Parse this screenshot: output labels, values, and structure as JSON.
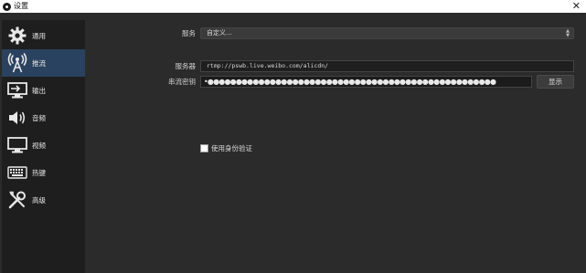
{
  "window": {
    "title": "设置"
  },
  "sidebar": {
    "items": [
      {
        "label": "通用",
        "icon": "gear-icon",
        "active": false
      },
      {
        "label": "推流",
        "icon": "broadcast-antenna-icon",
        "active": true
      },
      {
        "label": "输出",
        "icon": "output-monitor-icon",
        "active": false
      },
      {
        "label": "音频",
        "icon": "speaker-icon",
        "active": false
      },
      {
        "label": "视频",
        "icon": "monitor-icon",
        "active": false
      },
      {
        "label": "热键",
        "icon": "keyboard-icon",
        "active": false
      },
      {
        "label": "高级",
        "icon": "tools-icon",
        "active": false
      }
    ]
  },
  "stream": {
    "service_label": "服务",
    "service_value": "自定义...",
    "server_label": "服务器",
    "server_value": "rtmp://pswb.live.weibo.com/alicdn/",
    "key_label": "串流密钥",
    "key_masked": "•●●●●●●●●●●●●●●●●●●●●●●●●●●●●●●●●●●●●●●●●●●●●●●●●●●●",
    "show_label": "显示",
    "auth_label": "使用身份验证",
    "auth_checked": false
  },
  "colors": {
    "sidebar_bg": "#1e1e1e",
    "active_item": "#29425f",
    "panel_bg": "#2b2b2b"
  }
}
